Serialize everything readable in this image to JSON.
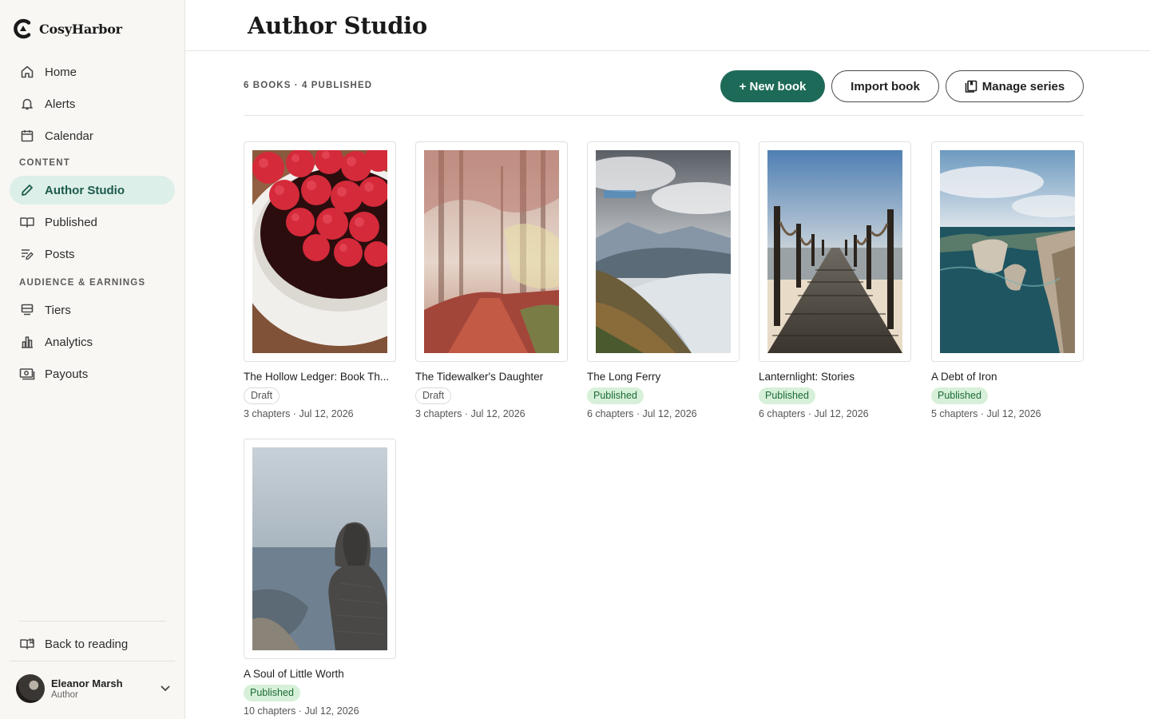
{
  "brand": {
    "name": "CosyHarbor"
  },
  "header": {
    "title": "Author Studio"
  },
  "nav": {
    "items": [
      {
        "label": "Home",
        "icon": "home-icon"
      },
      {
        "label": "Alerts",
        "icon": "bell-icon"
      },
      {
        "label": "Calendar",
        "icon": "calendar-icon"
      }
    ],
    "content_section": "CONTENT",
    "content_items": [
      {
        "label": "Author Studio",
        "icon": "pencil-icon",
        "active": true
      },
      {
        "label": "Published",
        "icon": "book-open-icon"
      },
      {
        "label": "Posts",
        "icon": "posts-icon"
      }
    ],
    "audience_section": "AUDIENCE & EARNINGS",
    "audience_items": [
      {
        "label": "Tiers",
        "icon": "tiers-icon"
      },
      {
        "label": "Analytics",
        "icon": "bar-chart-icon"
      },
      {
        "label": "Payouts",
        "icon": "payouts-icon"
      }
    ],
    "back_label": "Back to reading"
  },
  "user": {
    "name": "Eleanor Marsh",
    "role": "Author"
  },
  "toolbar": {
    "summary": "6 BOOKS · 4 PUBLISHED",
    "new_book": "+ New book",
    "import_book": "Import book",
    "manage_series": "Manage series"
  },
  "colors": {
    "accent": "#1e6a58",
    "active_nav_bg": "#dcefe8",
    "published_bg": "#d7f0d9",
    "published_text": "#1c6b37"
  },
  "books": [
    {
      "title": "The Hollow Ledger: Book Th...",
      "status": "Draft",
      "chapters": "3 chapters",
      "date": "Jul 12, 2026",
      "cover": "raspberries"
    },
    {
      "title": "The Tidewalker's Daughter",
      "status": "Draft",
      "chapters": "3 chapters",
      "date": "Jul 12, 2026",
      "cover": "misty-forest"
    },
    {
      "title": "The Long Ferry",
      "status": "Published",
      "chapters": "6 chapters",
      "date": "Jul 12, 2026",
      "cover": "mountain-lake"
    },
    {
      "title": "Lanternlight: Stories",
      "status": "Published",
      "chapters": "6 chapters",
      "date": "Jul 12, 2026",
      "cover": "pier"
    },
    {
      "title": "A Debt of Iron",
      "status": "Published",
      "chapters": "5 chapters",
      "date": "Jul 12, 2026",
      "cover": "sea-cliffs"
    },
    {
      "title": "A Soul of Little Worth",
      "status": "Published",
      "chapters": "10 chapters",
      "date": "Jul 12, 2026",
      "cover": "hooded-figure"
    }
  ]
}
